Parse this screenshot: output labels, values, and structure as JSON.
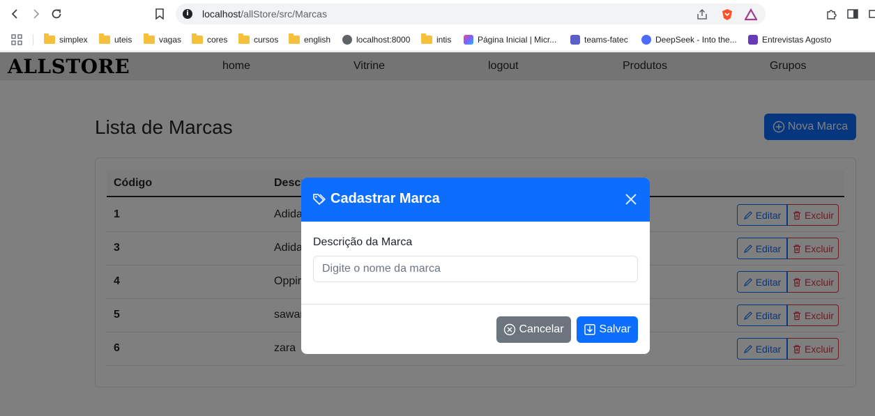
{
  "browser": {
    "url_host": "localhost",
    "url_path": "/allStore/src/Marcas",
    "bookmarks": [
      "simplex",
      "uteis",
      "vagas",
      "cores",
      "cursos",
      "english",
      "localhost:8000",
      "intis",
      "Página Inicial | Micr...",
      "teams-fatec",
      "DeepSeek - Into the...",
      "Entrevistas Agosto"
    ]
  },
  "site": {
    "brand": "ALLSTORE",
    "nav": [
      "home",
      "Vitrine",
      "logout",
      "Produtos",
      "Grupos"
    ]
  },
  "main": {
    "title": "Lista de Marcas",
    "new_button": "Nova Marca",
    "columns": [
      "Código",
      "Descri"
    ],
    "rows": [
      {
        "code": "1",
        "desc": "Adida"
      },
      {
        "code": "3",
        "desc": "Adida"
      },
      {
        "code": "4",
        "desc": "Oppir"
      },
      {
        "code": "5",
        "desc": "sawar"
      },
      {
        "code": "6",
        "desc": "zara"
      }
    ],
    "edit_label": "Editar",
    "delete_label": "Excluir"
  },
  "modal": {
    "title": "Cadastrar Marca",
    "field_label": "Descrição da Marca",
    "field_placeholder": "Digite o nome da marca",
    "field_value": "",
    "cancel_label": "Cancelar",
    "save_label": "Salvar"
  },
  "colors": {
    "primary": "#0d6efd",
    "danger": "#dc3545",
    "secondary": "#6c757d"
  }
}
